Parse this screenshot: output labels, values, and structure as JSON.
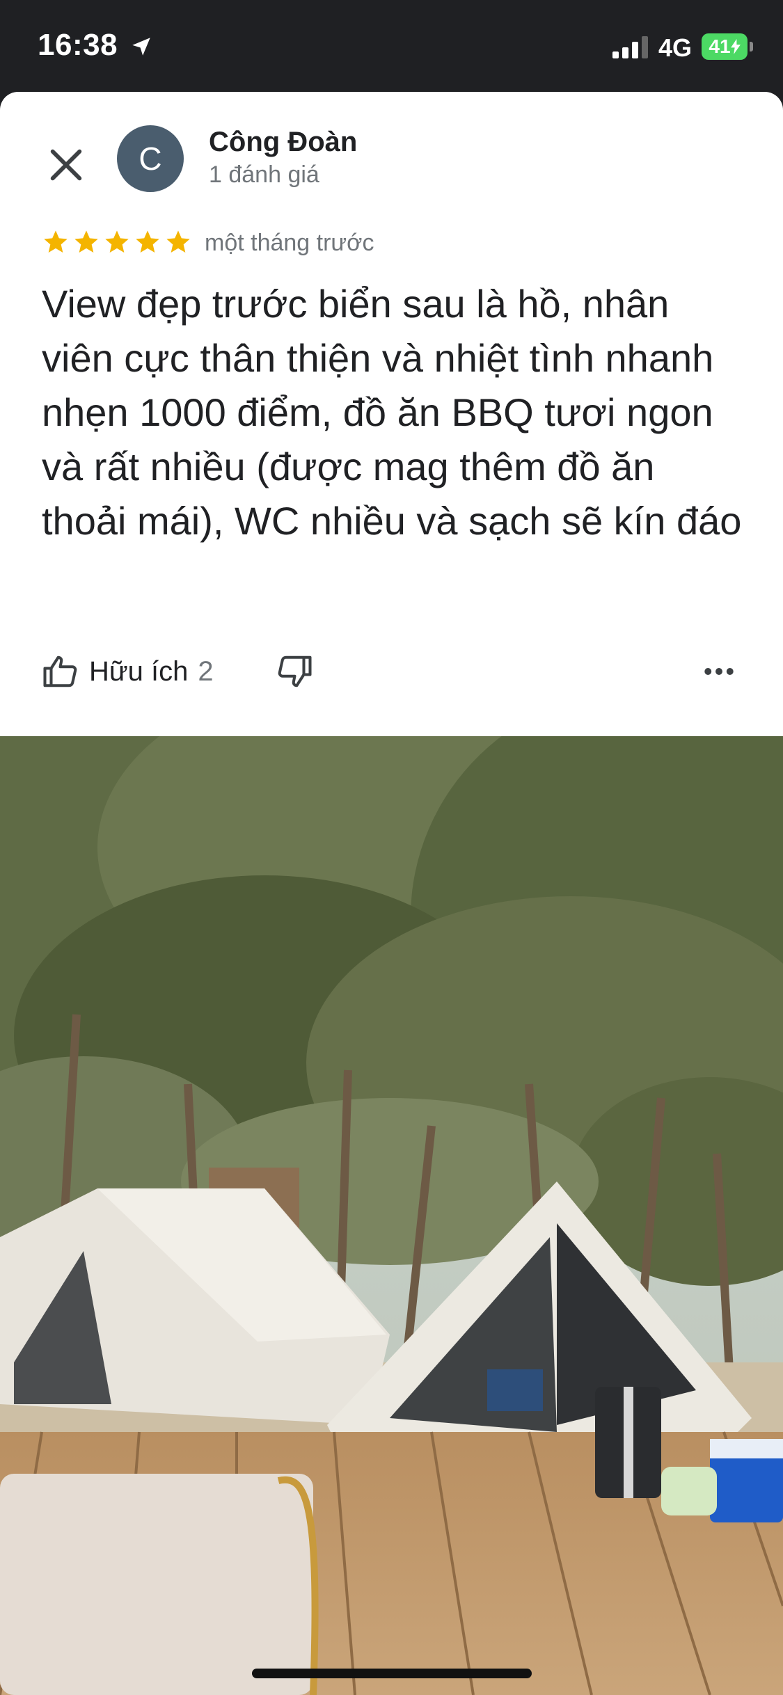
{
  "status_bar": {
    "time": "16:38",
    "network": "4G",
    "battery": "41"
  },
  "review": {
    "author": {
      "initial": "C",
      "name": "Công Đoàn",
      "meta": "1 đánh giá",
      "avatar_color": "#4a5d6e"
    },
    "rating": 5,
    "time_ago": "một tháng trước",
    "text": "View đẹp trước biển sau là hồ, nhân viên cực thân thiện và nhiệt tình nhanh nhẹn 1000 điểm, đồ ăn BBQ tươi ngon và rất nhiều (được mag thêm đồ ăn thoải mái), WC nhiều và sạch sẽ kín đáo",
    "actions": {
      "helpful_label": "Hữu ích",
      "helpful_count": "2"
    }
  },
  "icons": {
    "close": "close-icon",
    "location": "location-arrow-icon",
    "signal": "signal-icon",
    "star": "star-icon",
    "thumb_up": "thumb-up-icon",
    "thumb_down": "thumb-down-icon",
    "more": "more-horiz-icon"
  },
  "colors": {
    "star": "#f4b400",
    "text": "#202124",
    "secondary": "#70757a",
    "battery": "#4cd964"
  }
}
